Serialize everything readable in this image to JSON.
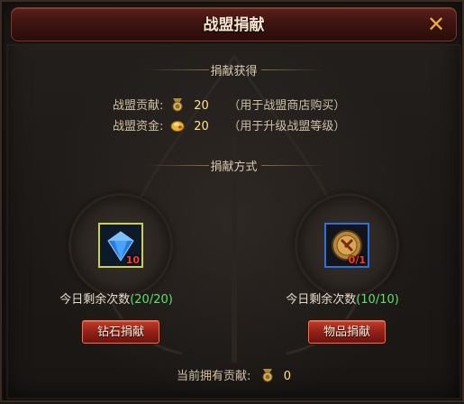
{
  "window": {
    "title": "战盟捐献"
  },
  "icons": {
    "close": "close-icon",
    "contribution": "contribution-medal-icon",
    "funds": "gold-coin-icon",
    "diamond": "blue-diamond-icon",
    "medal": "donation-medal-icon"
  },
  "gain": {
    "heading": "捐献获得",
    "contribution": {
      "label": "战盟贡献:",
      "value": "20",
      "note": "（用于战盟商店购买）"
    },
    "funds": {
      "label": "战盟资金:",
      "value": "20",
      "note": "（用于升级战盟等级）"
    }
  },
  "methods": {
    "heading": "捐献方式",
    "diamond": {
      "count": "10",
      "remain_label": "今日剩余次数",
      "remain_value": "(20/20)",
      "button": "钻石捐献"
    },
    "item": {
      "count": "0/1",
      "remain_label": "今日剩余次数",
      "remain_value": "(10/10)",
      "button": "物品捐献"
    }
  },
  "footer": {
    "label": "当前拥有贡献:",
    "value": "0"
  },
  "colors": {
    "accent_gold": "#ffe08a",
    "remain_green": "#5fe06a",
    "count_red": "#ff3a2a",
    "button_red": "#8e1f16"
  }
}
